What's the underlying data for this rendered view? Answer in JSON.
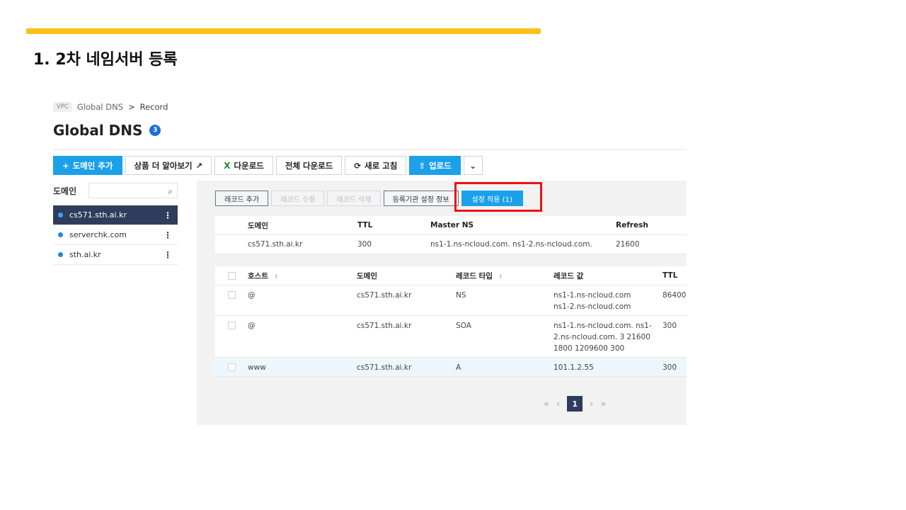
{
  "slide": {
    "title": "1. 2차 네임서버 등록"
  },
  "breadcrumb": {
    "badge": "VPC",
    "items": [
      "Global DNS",
      "Record"
    ],
    "separator": ">"
  },
  "page": {
    "title": "Global DNS",
    "count": "3"
  },
  "toolbar": {
    "add_domain": "도메인 추가",
    "add_icon": "+",
    "learn_more": "상품 더 알아보기",
    "learn_more_icon": "↗",
    "download": "다운로드",
    "download_icon": "X",
    "download_all": "전체 다운로드",
    "refresh": "새로 고침",
    "refresh_icon": "⟳",
    "upload": "업로드",
    "upload_icon": "⇧",
    "more_icon": "⌄"
  },
  "domain_panel": {
    "label": "도메인",
    "search_icon": "⌕",
    "items": [
      {
        "name": "cs571.sth.ai.kr",
        "active": true
      },
      {
        "name": "serverchk.com",
        "active": false
      },
      {
        "name": "sth.ai.kr",
        "active": false
      }
    ],
    "kebab": "⋮"
  },
  "record_toolbar": {
    "add": "레코드 추가",
    "edit": "레코드 수정",
    "delete": "레코드 삭제",
    "registrar": "등록기관 설정 정보",
    "apply": "설정 적용 (1)"
  },
  "ns_table": {
    "headers": [
      "도메인",
      "TTL",
      "Master NS",
      "Refresh"
    ],
    "row": [
      "cs571.sth.ai.kr",
      "300",
      "ns1-1.ns-ncloud.com. ns1-2.ns-ncloud.com.",
      "21600"
    ]
  },
  "record_table": {
    "headers": [
      "호스트",
      "도메인",
      "레코드 타입",
      "레코드 값",
      "TTL"
    ],
    "sort_icon": "⇕",
    "rows": [
      {
        "host": "@",
        "domain": "cs571.sth.ai.kr",
        "type": "NS",
        "value_lines": [
          "ns1-1.ns-ncloud.com",
          "ns1-2.ns-ncloud.com"
        ],
        "ttl": "86400"
      },
      {
        "host": "@",
        "domain": "cs571.sth.ai.kr",
        "type": "SOA",
        "value_lines": [
          "ns1-1.ns-ncloud.com. ns1-",
          "2.ns-ncloud.com. 3 21600",
          "1800 1209600 300"
        ],
        "ttl": "300"
      },
      {
        "host": "www",
        "domain": "cs571.sth.ai.kr",
        "type": "A",
        "value_lines": [
          "101.1.2.55"
        ],
        "ttl": "300"
      }
    ]
  },
  "pagination": {
    "first": "«",
    "prev": "‹",
    "current": "1",
    "next": "›",
    "last": "»"
  },
  "colors": {
    "accent": "#1ba0ea",
    "highlight": "#e11111",
    "title_bar": "#fbbf1a",
    "active_nav": "#2f3d5c"
  }
}
